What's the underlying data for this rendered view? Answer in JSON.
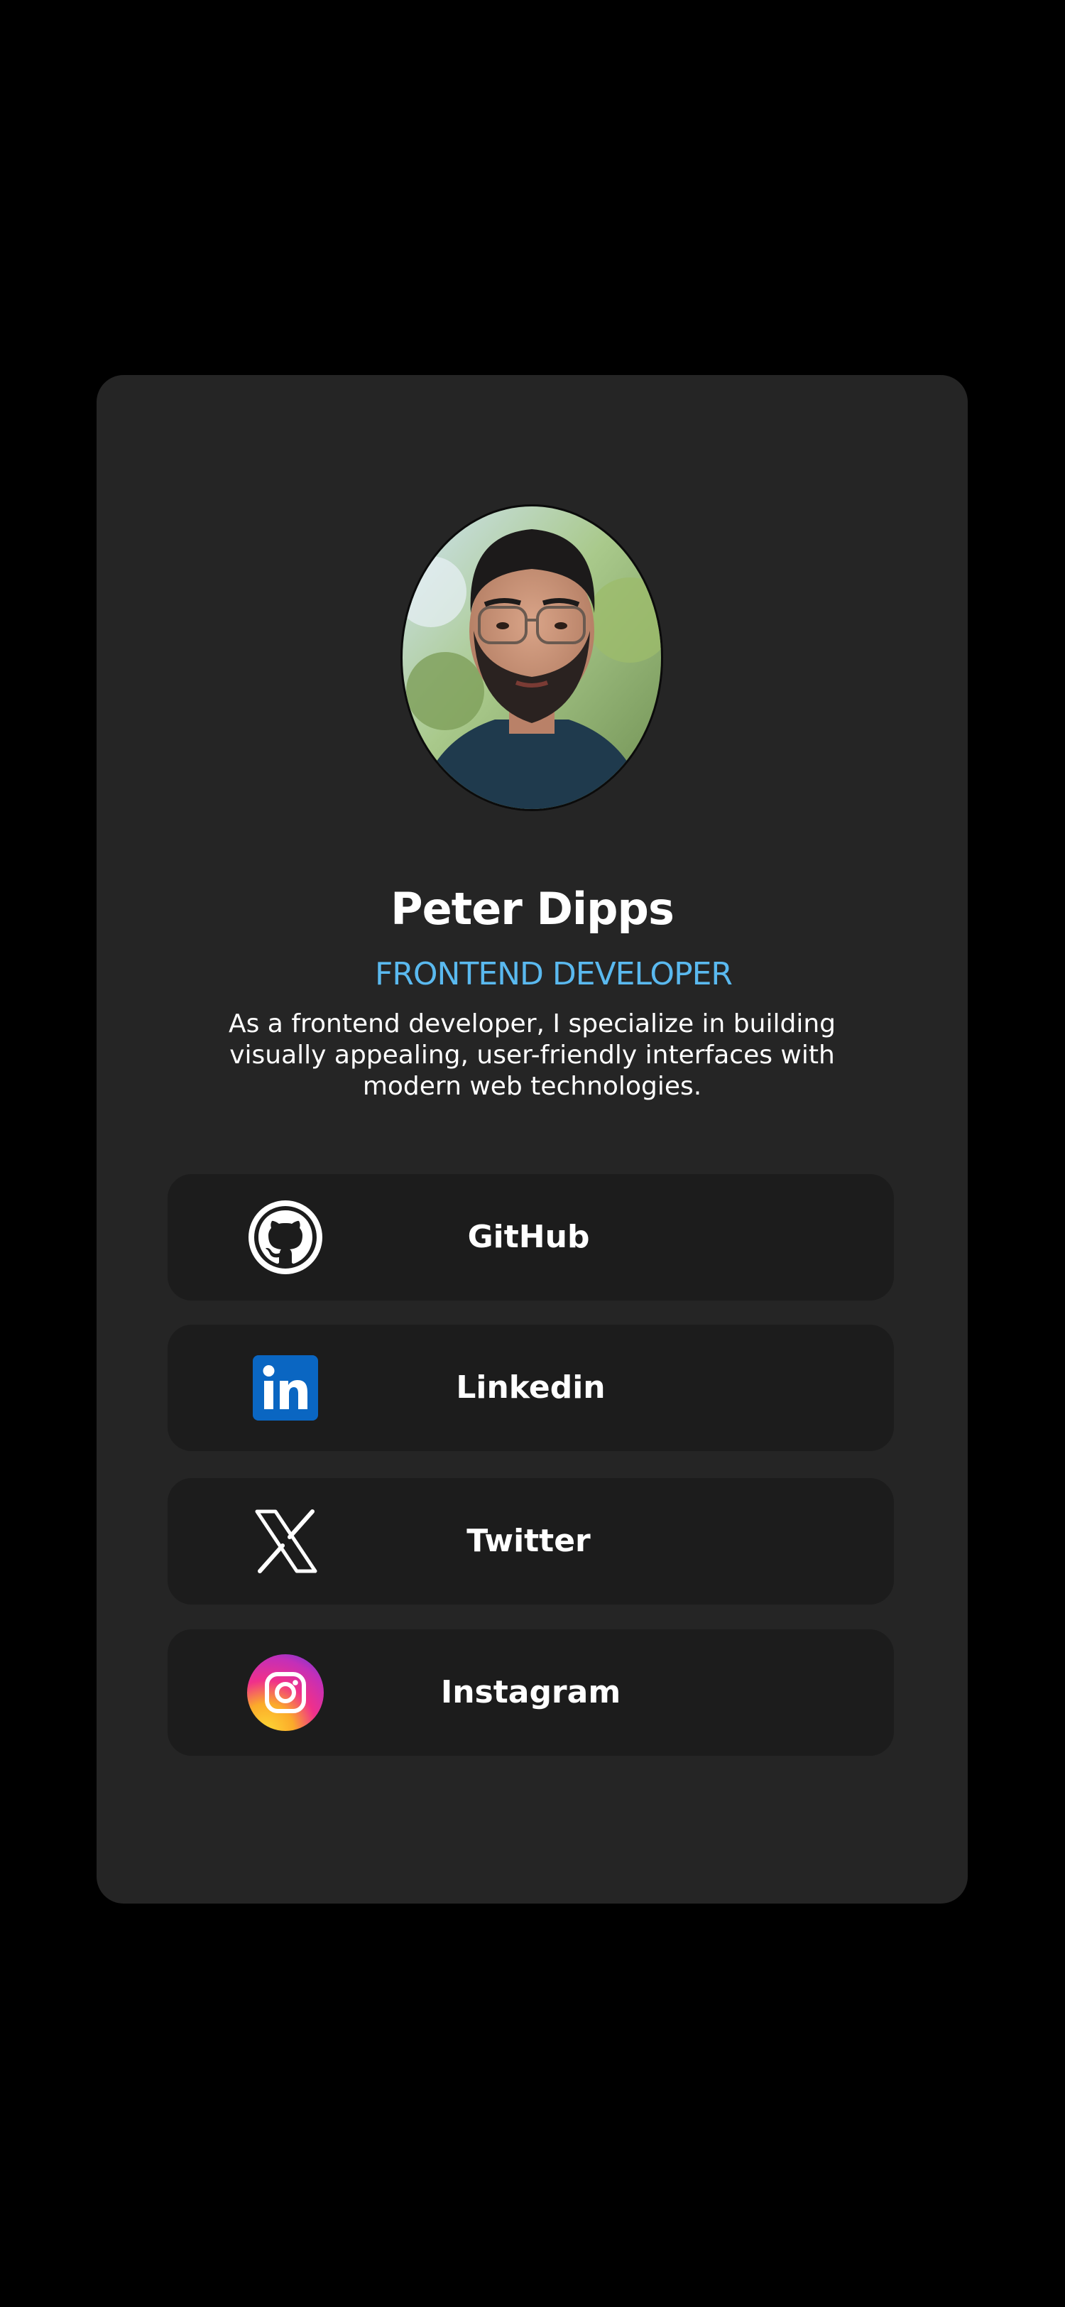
{
  "profile": {
    "name": "Peter Dipps",
    "role": "FRONTEND DEVELOPER",
    "bio": "As a frontend developer, I specialize in building visually appealing, user-friendly interfaces with modern web technologies."
  },
  "links": [
    {
      "label": "GitHub",
      "icon": "github-icon"
    },
    {
      "label": "Linkedin",
      "icon": "linkedin-icon"
    },
    {
      "label": "Twitter",
      "icon": "x-twitter-icon"
    },
    {
      "label": "Instagram",
      "icon": "instagram-icon"
    }
  ],
  "colors": {
    "background": "#000000",
    "card": "#252525",
    "link_button": "#1c1c1c",
    "accent": "#5ab9ef",
    "text": "#ffffff",
    "linkedin_blue": "#0a66c2"
  }
}
